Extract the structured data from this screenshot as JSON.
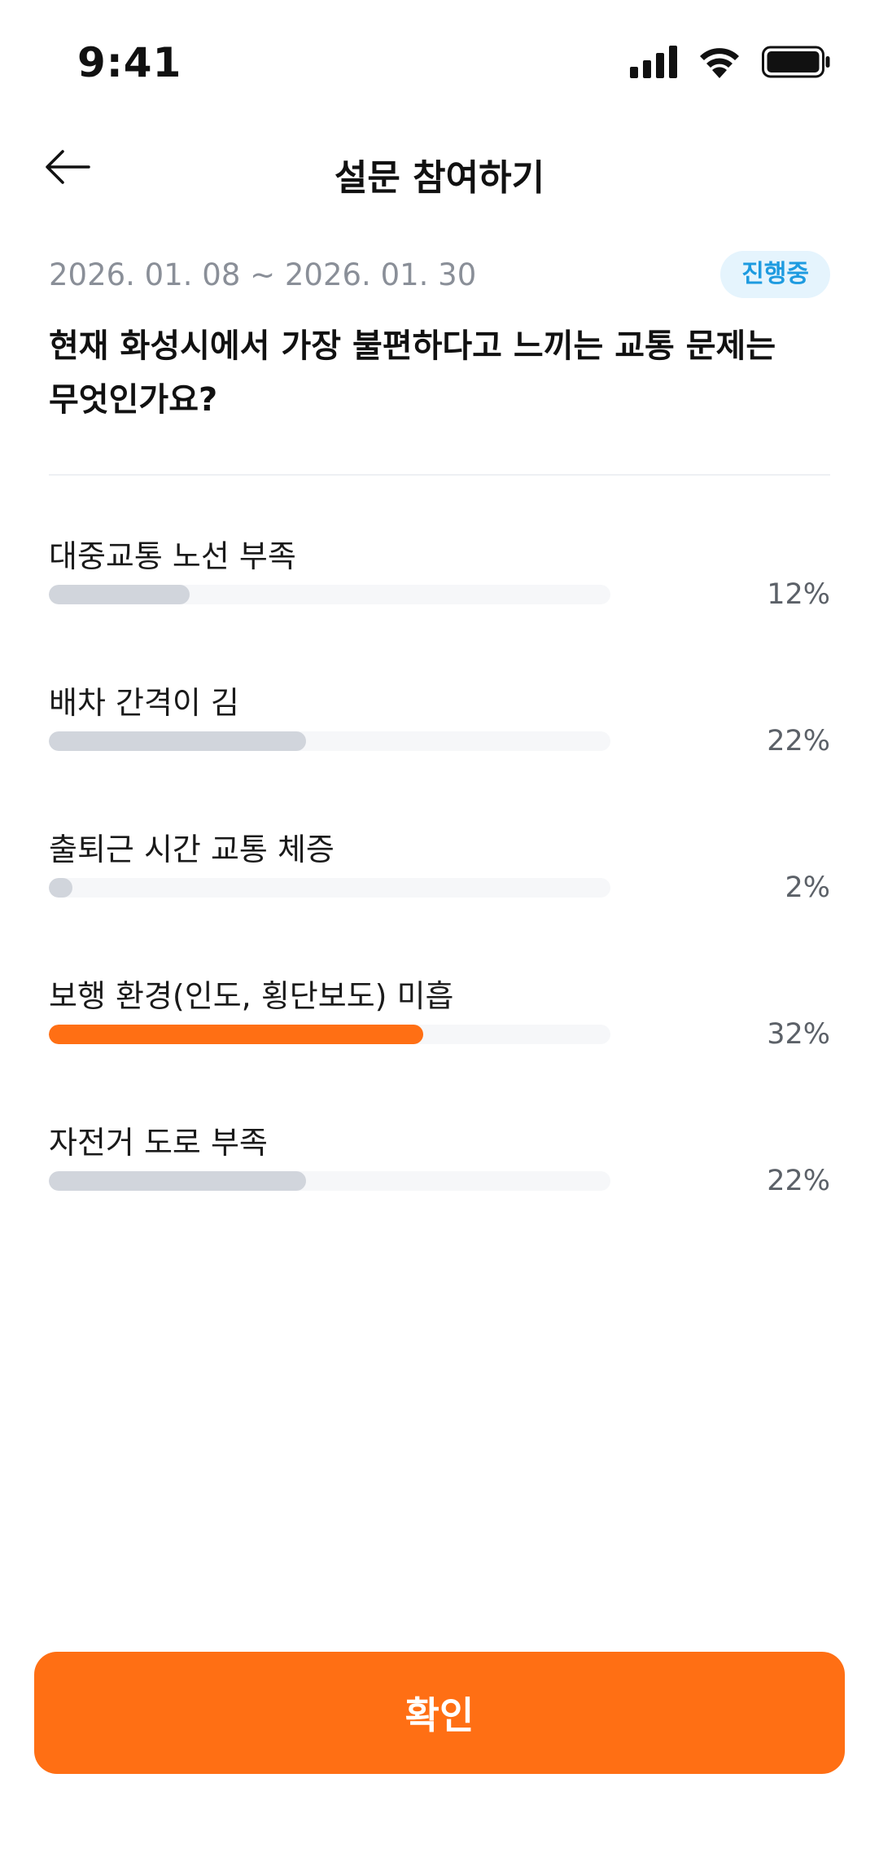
{
  "status_bar": {
    "time": "9:41",
    "icons": [
      "signal-icon",
      "wifi-icon",
      "battery-icon"
    ]
  },
  "header": {
    "title": "설문 참여하기",
    "back_icon": "arrow-left-icon"
  },
  "survey": {
    "date_range": "2026. 01. 08 ~ 2026. 01. 30",
    "status": "진행중",
    "question": "현재 화성시에서 가장 불편하다고 느끼는 교통 문제는 무엇인가요?"
  },
  "options": [
    {
      "label": "대중교통 노선 부족",
      "percent_text": "12%",
      "percent": 12,
      "selected": false
    },
    {
      "label": "배차 간격이 김",
      "percent_text": "22%",
      "percent": 22,
      "selected": false
    },
    {
      "label": "출퇴근 시간 교통 체증",
      "percent_text": "2%",
      "percent": 2,
      "selected": false
    },
    {
      "label": "보행 환경(인도, 횡단보도) 미흡",
      "percent_text": "32%",
      "percent": 32,
      "selected": true
    },
    {
      "label": "자전거 도로 부족",
      "percent_text": "22%",
      "percent": 22,
      "selected": false
    }
  ],
  "footer": {
    "confirm_label": "확인"
  },
  "colors": {
    "accent": "#ff6f14",
    "bar_default": "#d1d5dc",
    "bar_track": "#f6f7f9",
    "badge_bg": "#e5f4fd",
    "badge_text": "#1e9be0",
    "muted_text": "#8a8f98"
  }
}
